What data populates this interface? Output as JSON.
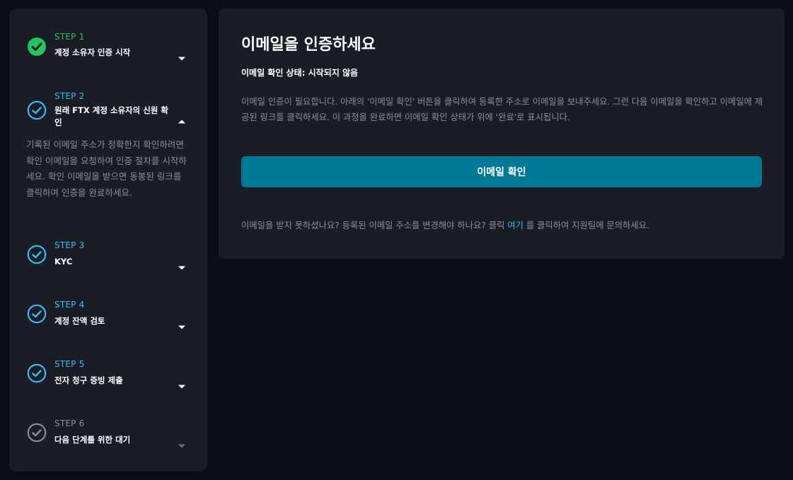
{
  "steps": [
    {
      "label": "STEP 1",
      "title": "계정 소유자 인증 시작",
      "state": "complete",
      "icon": "check-circle-filled-icon",
      "caret": "chevron-down-icon"
    },
    {
      "label": "STEP 2",
      "title": "원래 FTX 계정 소유자의 신원 확인",
      "state": "active",
      "icon": "check-circle-outline-icon",
      "caret": "chevron-up-icon",
      "description": "기록된 이메일 주소가 정확한지 확인하려면 확인 이메일을 요청하여 인증 절차를 시작하세요. 확인 이메일을 받으면 동봉된 링크를 클릭하여 인증을 완료하세요."
    },
    {
      "label": "STEP 3",
      "title": "KYC",
      "state": "pending",
      "icon": "check-circle-outline-icon",
      "caret": "chevron-down-icon"
    },
    {
      "label": "STEP 4",
      "title": "계정 잔액 검토",
      "state": "pending",
      "icon": "check-circle-outline-icon",
      "caret": "chevron-down-icon"
    },
    {
      "label": "STEP 5",
      "title": "전자 청구 증빙 제출",
      "state": "pending",
      "icon": "check-circle-outline-icon",
      "caret": "chevron-down-icon"
    },
    {
      "label": "STEP 6",
      "title": "다음 단계를 위한 대기",
      "state": "disabled",
      "icon": "check-circle-outline-icon",
      "caret": "chevron-down-icon"
    }
  ],
  "main": {
    "title": "이메일을 인증하세요",
    "status_label": "이메일 확인 상태:",
    "status_value": "시작되지 않음",
    "description": "이메일 인증이 필요합니다. 아래의 '이메일 확인' 버튼을 클릭하여 등록한 주소로 이메일을 보내주세요. 그런 다음 이메일을 확인하고 이메일에 제공된 링크를 클릭하세요. 이 과정을 완료하면 이메일 확인 상태가 위에 '완료'로 표시됩니다.",
    "verify_button": "이메일 확인",
    "help_before": "이메일을 받지 못하셨나요? 등록된 이메일 주소를 변경해야 하나요? 클릭",
    "help_link": "여기",
    "help_after": "를 클릭하여 지원팀에 문의하세요."
  },
  "colors": {
    "background": "#0b0e14",
    "panel": "#1a1d26",
    "complete": "#22c55e",
    "active": "#38bdf8",
    "disabled": "#8b8f99",
    "button": "#007a94",
    "muted_text": "#8a8f9c"
  }
}
